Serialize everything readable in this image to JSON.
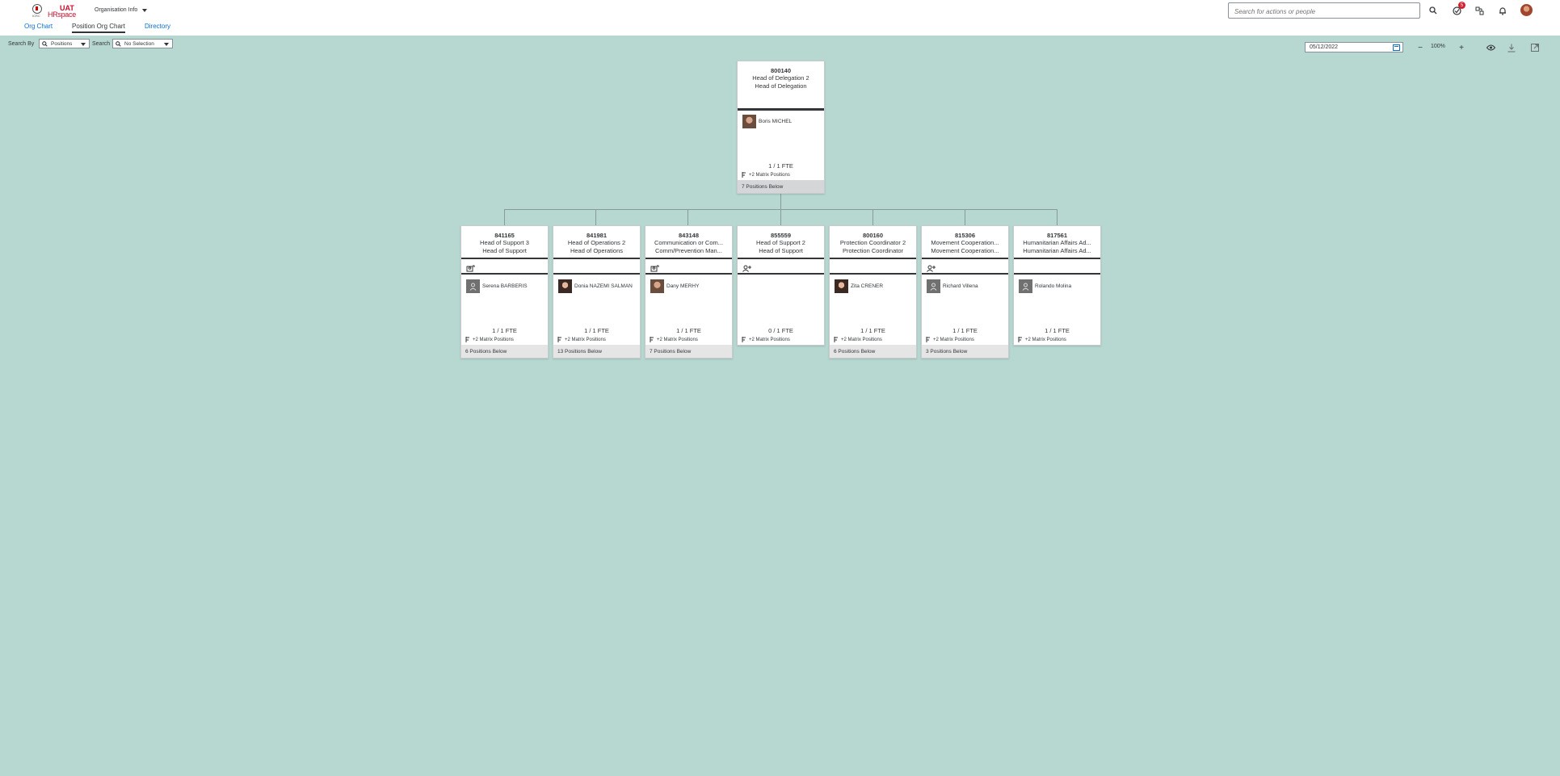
{
  "header": {
    "logo": {
      "icrc": "ICRC",
      "uat": "UAT",
      "hr": "HRspace"
    },
    "app_title": "Organisation Info",
    "search_placeholder": "Search for actions or people",
    "notification_count": "5"
  },
  "tabs": [
    {
      "label": "Org Chart",
      "selected": false
    },
    {
      "label": "Position Org Chart",
      "selected": true
    },
    {
      "label": "Directory",
      "selected": false
    }
  ],
  "toolbar": {
    "search_by_label": "Search By",
    "search_by_value": "Positions",
    "search_label": "Search",
    "search_value": "No Selection",
    "date": "05/12/2022",
    "zoom": "100%",
    "zoom_out": "−",
    "zoom_in": "+"
  },
  "root": {
    "id": "800140",
    "title1": "Head of Delegation 2",
    "title2": "Head of Delegation",
    "person": "Boris MICHEL",
    "fte": "1 / 1 FTE",
    "matrix": "+2 Matrix Positions",
    "below": "7 Positions Below"
  },
  "children": [
    {
      "id": "841165",
      "title1": "Head of Support 3",
      "title2": "Head of Support",
      "person": "Serena BARBERIS",
      "fte": "1 / 1 FTE",
      "matrix": "+2 Matrix Positions",
      "below": "6 Positions Below",
      "icon": "team-icon",
      "photo": "generic"
    },
    {
      "id": "841981",
      "title1": "Head of Operations 2",
      "title2": "Head of Operations",
      "person": "Donia NAZEMI SALMAN",
      "fte": "1 / 1 FTE",
      "matrix": "+2 Matrix Positions",
      "below": "13 Positions Below",
      "icon": "",
      "photo": "female"
    },
    {
      "id": "843148",
      "title1": "Communication or Com...",
      "title2": "Comm/Prevention Man...",
      "person": "Dany MERHY",
      "fte": "1 / 1 FTE",
      "matrix": "+2 Matrix Positions",
      "below": "7 Positions Below",
      "icon": "team-icon",
      "photo": "male"
    },
    {
      "id": "855559",
      "title1": "Head of Support 2",
      "title2": "Head of Support",
      "person": "",
      "fte": "0 / 1 FTE",
      "matrix": "+2 Matrix Positions",
      "below": "",
      "icon": "add-person-icon",
      "photo": "none"
    },
    {
      "id": "800160",
      "title1": "Protection Coordinator 2",
      "title2": "Protection Coordinator",
      "person": "Zita CRENER",
      "fte": "1 / 1 FTE",
      "matrix": "+2 Matrix Positions",
      "below": "6 Positions Below",
      "icon": "",
      "photo": "female"
    },
    {
      "id": "815306",
      "title1": "Movement Cooperation...",
      "title2": "Movement Cooperation...",
      "person": "Richard Villena",
      "fte": "1 / 1 FTE",
      "matrix": "+2 Matrix Positions",
      "below": "3 Positions Below",
      "icon": "add-person-icon",
      "photo": "generic"
    },
    {
      "id": "817561",
      "title1": "Humanitarian Affairs Ad...",
      "title2": "Humanitarian Affairs Ad...",
      "person": "Rolando Molina",
      "fte": "1 / 1 FTE",
      "matrix": "+2 Matrix Positions",
      "below": "",
      "icon": "",
      "photo": "generic"
    }
  ]
}
